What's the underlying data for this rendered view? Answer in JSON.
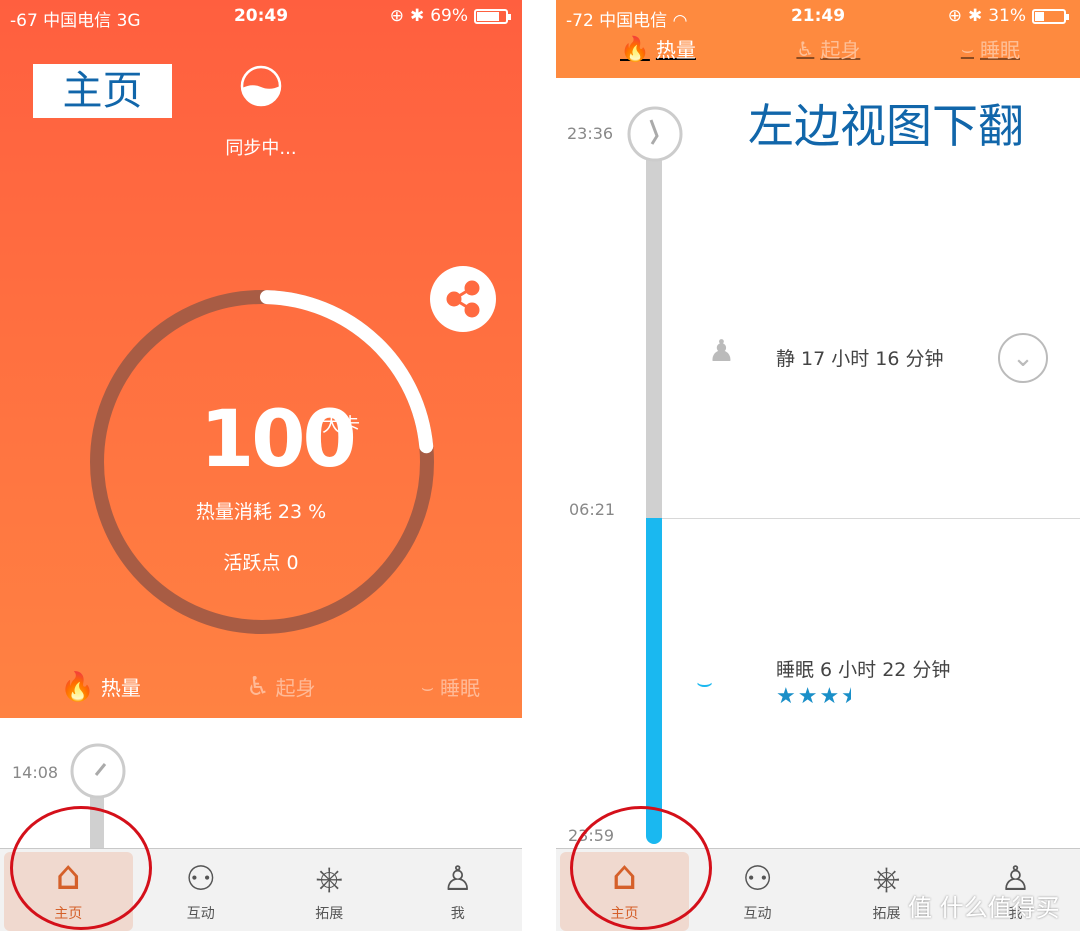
{
  "left": {
    "status": {
      "signal": "-67 中国电信  3G",
      "time": "20:49",
      "battery": "69%",
      "battery_level": 0.69
    },
    "annotation": "主页",
    "sync_text": "同步中...",
    "calories": {
      "value": "100",
      "unit": "大卡",
      "percent_label": "热量消耗 23 %",
      "progress": 0.23,
      "active_label": "活跃点 0"
    },
    "tabs": [
      {
        "label": "热量",
        "icon": "flame-icon"
      },
      {
        "label": "起身",
        "icon": "sit-up-icon"
      },
      {
        "label": "睡眠",
        "icon": "sleep-eye-icon"
      }
    ],
    "timeline_time": "14:08"
  },
  "right": {
    "status": {
      "signal": "-72 中国电信",
      "time": "21:49",
      "battery": "31%",
      "battery_level": 0.31
    },
    "tabs": [
      {
        "label": "热量",
        "icon": "flame-icon"
      },
      {
        "label": "起身",
        "icon": "sit-up-icon"
      },
      {
        "label": "睡眠",
        "icon": "sleep-eye-icon"
      }
    ],
    "annotation": "左边视图下翻",
    "times": [
      "23:36",
      "06:21",
      "23:59"
    ],
    "still": "静 17 小时 16 分钟",
    "sleep": "睡眠 6 小时 22 分钟",
    "sleep_rating": 3.5
  },
  "tabbar": [
    {
      "label": "主页",
      "icon": "home-icon"
    },
    {
      "label": "互动",
      "icon": "people-icon"
    },
    {
      "label": "拓展",
      "icon": "wheel-icon"
    },
    {
      "label": "我",
      "icon": "person-icon"
    }
  ],
  "watermark": "值 什么值得买",
  "colors": {
    "orange": "#ff6a40",
    "blue": "#1ab8f0",
    "annotation_blue": "#1166aa",
    "circle_red": "#d4101a"
  }
}
